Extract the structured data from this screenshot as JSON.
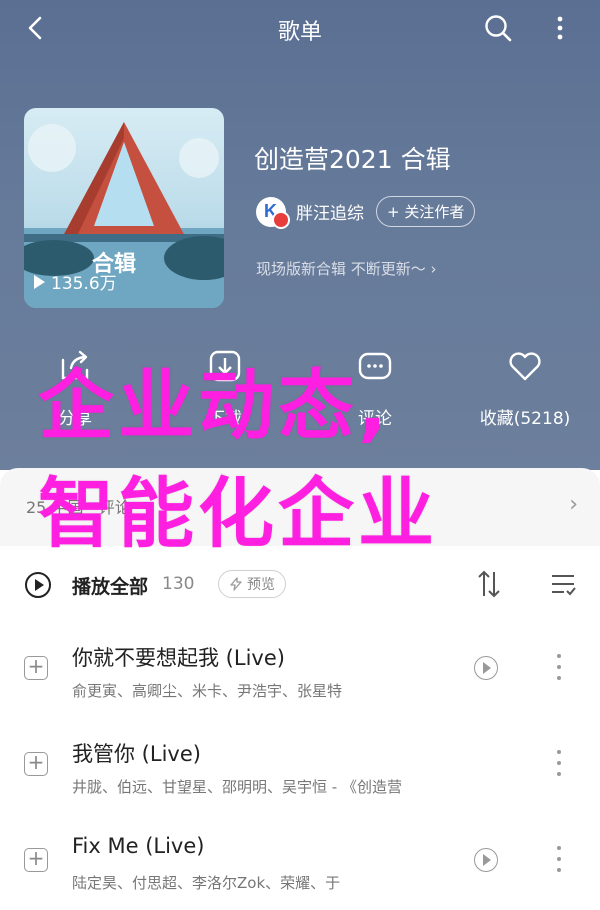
{
  "nav": {
    "title": "歌单"
  },
  "album": {
    "title": "创造营2021 合辑",
    "cover_text": "合辑",
    "play_count": "135.6万",
    "artist": "胖汪追综",
    "follow_label": "+ 关注作者",
    "description": "现场版新合辑 不断更新～ ›"
  },
  "actions": [
    {
      "label": "分享",
      "icon": "share-icon"
    },
    {
      "label": "下载",
      "icon": "download-icon"
    },
    {
      "label": "评论",
      "icon": "comment-icon"
    },
    {
      "label": "收藏(5218)",
      "icon": "heart-icon"
    }
  ],
  "overlay": {
    "line1": "企业动态,",
    "line2": "智能化企业"
  },
  "comment_bar": {
    "label": "25 中国 · 评论",
    "chevron": "›"
  },
  "list_header": {
    "play_all": "播放全部",
    "count": "130",
    "preview": "预览"
  },
  "songs": [
    {
      "name": "你就不要想起我 (Live)",
      "artists": "俞更寅、高卿尘、米卡、尹浩宇、张星特"
    },
    {
      "name": "我管你 (Live)",
      "artists": "井胧、伯远、甘望星、邵明明、吴宇恒 - 《创造营"
    },
    {
      "name": "Fix Me (Live)",
      "artists": "陆定昊、付思超、李洛尔Zok、荣耀、于"
    }
  ],
  "colors": {
    "header_bg": "#5b6f93",
    "overlay_text": "#ff1fe0",
    "badge": "#e73d3d"
  }
}
